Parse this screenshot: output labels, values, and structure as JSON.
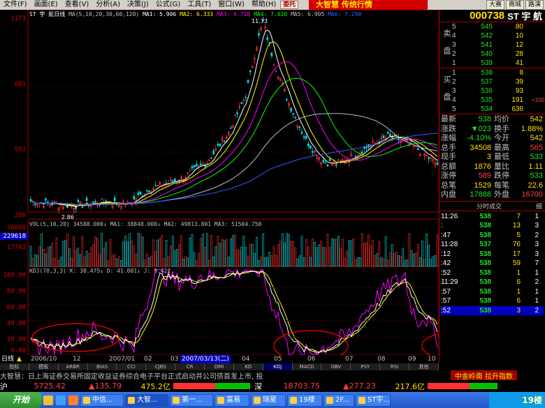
{
  "menubar": {
    "items": [
      "文件(F)",
      "画面(E)",
      "查看(V)",
      "分析(A)",
      "决策(J)",
      "公式(G)",
      "工具(T)",
      "窗口(W)",
      "帮助(H)"
    ],
    "button_weituo": "委托",
    "brand": "大智慧 传统行情",
    "right_buttons": [
      "大赛",
      "商城",
      "路演"
    ]
  },
  "header": {
    "code": "000738",
    "name": "ST 宇 航"
  },
  "chart": {
    "title_line": "ST 宇 航日线",
    "ma_legend": [
      "MA(5,10,20,30,60,120)",
      "MA1: 5.906",
      "MA2: 6.333",
      "MA3: 6.718",
      "MA4: 7.020",
      "MA5: 6.905",
      "MA6: 7.290"
    ],
    "price_axis": [
      "1173",
      "881",
      "592",
      "286"
    ],
    "high_label": "11.73",
    "low_label": "2.86",
    "vol_legend": "VOL(5,10,20) 34588.000↓ MA1: 38848.000↓ MA2: 49813.801 MA3: 51504.750",
    "vol_axis": [
      "36008",
      "229618",
      "17743"
    ],
    "kdj_legend": "KDJ(70,3,3) K: 30.475↓ D: 41.001↓ J: 9.422",
    "kdj_axis": [
      "100.00",
      "80.00",
      "60.00",
      "40.00",
      "20.00",
      "0.00"
    ],
    "date_labels": [
      "2006/10",
      "12",
      "2007/01",
      "02",
      "03",
      "2007/03/13(二)",
      "04",
      "05",
      "06",
      "07",
      "08",
      "09",
      "10"
    ],
    "period": "日线",
    "colors": {
      "ma1": "#ffffff",
      "ma2": "#ffff00",
      "ma3": "#ff00ff",
      "ma4": "#00ff00",
      "ma5": "#c0c0c0",
      "ma6": "#3060ff",
      "kdj_k": "#ffffff",
      "kdj_d": "#ffff00",
      "kdj_j": "#ff00ff",
      "circle": "#ff0000",
      "up": "#ff3030",
      "down": "#00e0e0"
    }
  },
  "tabs": [
    "指标",
    "模板",
    "ARBR",
    "BIAS",
    "CCI",
    "CJBS",
    "CR",
    "DMI",
    "KD",
    "KDJ",
    "MACD",
    "OBV",
    "PSY",
    "RSI",
    "其他"
  ],
  "order_book": {
    "sell_label": "卖盘",
    "buy_label": "买盘",
    "sell": [
      {
        "level": "5",
        "price": "545",
        "vol": "80"
      },
      {
        "level": "4",
        "price": "542",
        "vol": "10"
      },
      {
        "level": "3",
        "price": "541",
        "vol": "12"
      },
      {
        "level": "2",
        "price": "540",
        "vol": "28"
      },
      {
        "level": "1",
        "price": "539",
        "vol": "41"
      }
    ],
    "buy": [
      {
        "level": "1",
        "price": "538",
        "vol": "8",
        "chg": ""
      },
      {
        "level": "2",
        "price": "537",
        "vol": "39",
        "chg": ""
      },
      {
        "level": "3",
        "price": "536",
        "vol": "93",
        "chg": ""
      },
      {
        "level": "4",
        "price": "535",
        "vol": "191",
        "chg": "+100"
      },
      {
        "level": "5",
        "price": "534",
        "vol": "636",
        "chg": ""
      }
    ]
  },
  "stats": [
    {
      "l1": "最新",
      "v1": "538",
      "l2": "均价",
      "v2": "542"
    },
    {
      "l1": "涨跌",
      "v1": "▼023",
      "l2": "换手",
      "v2": "1.88%"
    },
    {
      "l1": "涨幅",
      "v1": "-4.10%",
      "l2": "今开",
      "v2": "542"
    },
    {
      "l1": "总手",
      "v1": "34508",
      "l2": "最高",
      "v2": "565"
    },
    {
      "l1": "现手",
      "v1": "3",
      "l2": "最低",
      "v2": "533"
    },
    {
      "l1": "总额",
      "v1": "1876",
      "l2": "量比",
      "v2": "1.11"
    },
    {
      "l1": "涨停",
      "v1": "589",
      "l2": "跌停",
      "v2": "533"
    },
    {
      "l1": "总笔",
      "v1": "1529",
      "l2": "每笔",
      "v2": "22.6"
    },
    {
      "l1": "内盘",
      "v1": "17888",
      "l2": "外盘",
      "v2": "16700"
    }
  ],
  "trades_header": {
    "title": "分时成交",
    "detail": "细"
  },
  "trades": [
    {
      "time": "11:26",
      "price": "538",
      "vol": "7",
      "n": "1"
    },
    {
      "time": ":",
      "price": "538",
      "vol": "13",
      "n": "3"
    },
    {
      "time": ":47",
      "price": "538",
      "vol": "5",
      "n": "2"
    },
    {
      "time": "11:28",
      "price": "537",
      "vol": "76",
      "n": "3"
    },
    {
      "time": ":12",
      "price": "538",
      "vol": "17",
      "n": "3"
    },
    {
      "time": ":42",
      "price": "538",
      "vol": "59",
      "n": "7"
    },
    {
      "time": ":52",
      "price": "538",
      "vol": "1",
      "n": "1"
    },
    {
      "time": "11:29",
      "price": "538",
      "vol": "6",
      "n": "2"
    },
    {
      "time": ":57",
      "price": "538",
      "vol": "1",
      "n": "1"
    },
    {
      "time": ":57",
      "price": "538",
      "vol": "6",
      "n": "1"
    },
    {
      "time": ":52",
      "price": "538",
      "vol": "3",
      "n": "2"
    }
  ],
  "ticker": {
    "text": "大智慧：日上海证券交易所固定收益证券综合电子平台正式启动并公司债首发上市, 投",
    "right": "中金岭南 拉升指数"
  },
  "index_bar": {
    "sh_label": "沪",
    "sh_value": "5725.42",
    "sh_change": "▲135.79",
    "sh_amount": "475.2亿",
    "sz_label": "深",
    "sz_value": "18703.75",
    "sz_change": "▲277.23",
    "sz_amount": "217.6亿"
  },
  "taskbar": {
    "start": "开始",
    "buttons": [
      "中信...",
      "大智...",
      "第一...",
      "富易",
      "瑞星",
      "19楼",
      "2F...",
      "ST宇..."
    ],
    "watermark": "19楼"
  }
}
